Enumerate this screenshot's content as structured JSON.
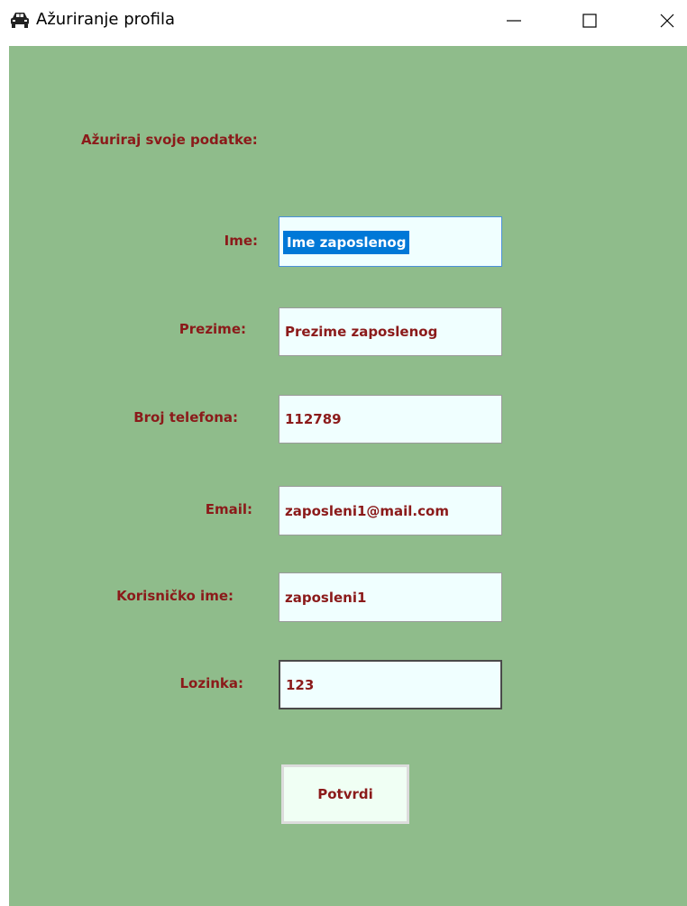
{
  "window": {
    "title": "Ažuriranje profila",
    "icon": "car-icon"
  },
  "form": {
    "heading": "Ažuriraj svoje podatke:",
    "fields": [
      {
        "label": "Ime:",
        "value": "Ime zaposlenog"
      },
      {
        "label": "Prezime:",
        "value": "Prezime zaposlenog"
      },
      {
        "label": "Broj telefona:",
        "value": "112789"
      },
      {
        "label": "Email:",
        "value": "zaposleni1@mail.com"
      },
      {
        "label": "Korisničko ime:",
        "value": "zaposleni1"
      },
      {
        "label": "Lozinka:",
        "value": "123"
      }
    ],
    "submit_label": "Potvrdi"
  },
  "colors": {
    "background": "#8fbc8b",
    "label_text": "#8b1a1a",
    "field_bg": "#f0ffff",
    "selection": "#0078d7"
  }
}
